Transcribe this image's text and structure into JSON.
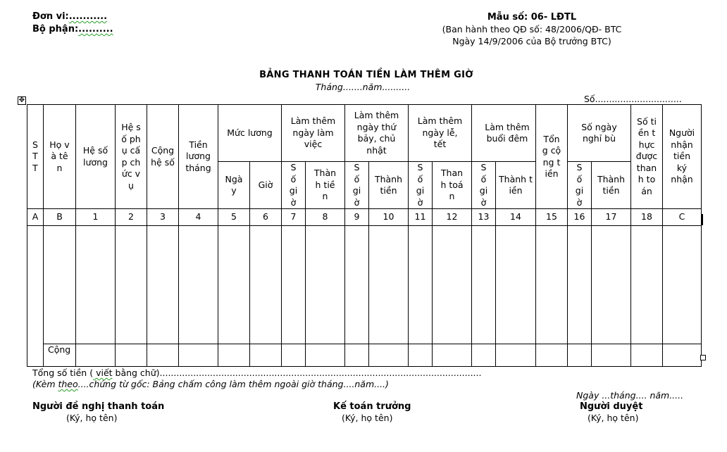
{
  "header_left": {
    "unit_label": "Đơn vi:",
    "unit_value": "...........",
    "dept_label": "Bộ phận:",
    "dept_value": ".........."
  },
  "header_right": {
    "form_number": "Mẫu số: 06- LĐTL",
    "issued_by_line1": "(Ban hành theo QĐ số: 48/2006/QĐ- BTC",
    "issued_by_line2": "Ngày 14/9/2006 của Bộ trưởng BTC)"
  },
  "title": {
    "main": "BẢNG THANH TOÁN TIỀN LÀM THÊM GIỜ",
    "period": "Tháng.......năm..........",
    "number": "Số..............................."
  },
  "table": {
    "headers": {
      "stt": "S T T",
      "name": "Họ và tên",
      "coef": "Hệ số lương",
      "allowance_coef": "Hệ số phụ cấp chức vụ",
      "total_coef": "Cộng hệ số",
      "monthly_salary": "Tiền lương tháng",
      "salary_level": "Mức lương",
      "salary_day": "Ngày",
      "salary_hour": "Giờ",
      "weekday_ot": "Làm thêm ngày làm việc",
      "weekend_ot": "Làm thêm ngày thứ bảy, chủ nhật",
      "holiday_ot": "Làm thêm ngày lễ, tết",
      "night_ot": "Làm thêm buổi đêm",
      "total_amount": "Tổng cộng tiền",
      "comp_days": "Số ngày nghỉ bù",
      "net_paid": "Số tiền thực được thanh toán",
      "recipient_sign": "Người nhận tiền ký nhận",
      "hours": "Số giờ",
      "amount": "Thành tiền",
      "amount_toan": "Thanh toán"
    },
    "column_codes": [
      "A",
      "B",
      "1",
      "2",
      "3",
      "4",
      "5",
      "6",
      "7",
      "8",
      "9",
      "10",
      "11",
      "12",
      "13",
      "14",
      "15",
      "16",
      "17",
      "18",
      "C"
    ],
    "total_row_label": "Cộng"
  },
  "footer": {
    "total_in_words": "Tổng số tiền (",
    "total_in_words_squig": " viết",
    "total_in_words_rest": " bằng chữ)...................................................................................................................",
    "attached_pre": "(Kèm ",
    "attached_squig": "theo",
    "attached_rest": "....chứng từ gốc: Bảng chấm công làm thêm ngoài giờ tháng....năm....)",
    "date_line": "Ngày ...tháng.... năm.....",
    "signers": [
      {
        "title": "Người đề nghị thanh toán",
        "note": "(Ký, họ tên)"
      },
      {
        "title": "Kế toán trưởng",
        "note": "(Ký, họ tên)"
      },
      {
        "title": "Người duyệt",
        "note": "(Ký, họ tên)"
      }
    ]
  }
}
